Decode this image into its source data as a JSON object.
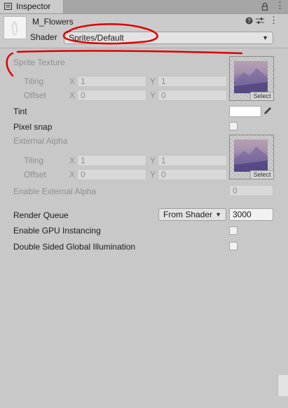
{
  "window": {
    "tab_label": "Inspector",
    "tab_icon": "info-icon",
    "lock_icon": "lock-icon",
    "menu_icon": "kebab-menu-icon"
  },
  "material": {
    "name": "M_Flowers",
    "shader_label": "Shader",
    "shader_value": "Sprites/Default",
    "help_icon": "help-icon",
    "settings_icon": "sliders-icon",
    "more_icon": "kebab-menu-icon"
  },
  "sprite_texture": {
    "label": "Sprite Texture",
    "tiling_label": "Tiling",
    "offset_label": "Offset",
    "x_label": "X",
    "y_label": "Y",
    "tiling_x": "1",
    "tiling_y": "1",
    "offset_x": "0",
    "offset_y": "0",
    "select_label": "Select"
  },
  "tint": {
    "label": "Tint",
    "color": "#ffffff",
    "picker_icon": "eyedropper-icon"
  },
  "pixel_snap": {
    "label": "Pixel snap",
    "checked": false
  },
  "external_alpha": {
    "label": "External Alpha",
    "tiling_label": "Tiling",
    "offset_label": "Offset",
    "x_label": "X",
    "y_label": "Y",
    "tiling_x": "1",
    "tiling_y": "1",
    "offset_x": "0",
    "offset_y": "0",
    "select_label": "Select"
  },
  "enable_external_alpha": {
    "label": "Enable External Alpha",
    "value": "0"
  },
  "render_queue": {
    "label": "Render Queue",
    "dropdown": "From Shader",
    "value": "3000"
  },
  "gpu_instancing": {
    "label": "Enable GPU Instancing",
    "checked": false
  },
  "double_sided_gi": {
    "label": "Double Sided Global Illumination",
    "checked": false
  },
  "colors": {
    "annotation": "#e00000",
    "panel_bg": "#c8c8c8"
  }
}
